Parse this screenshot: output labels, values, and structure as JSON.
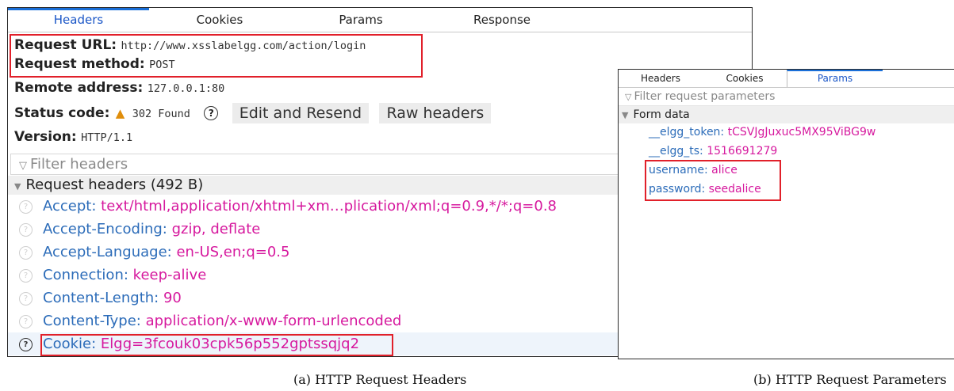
{
  "panel_a": {
    "tabs": [
      "Headers",
      "Cookies",
      "Params",
      "Response"
    ],
    "request_url_label": "Request URL:",
    "request_url_value": "http://www.xsslabelgg.com/action/login",
    "request_method_label": "Request method:",
    "request_method_value": "POST",
    "remote_address_label": "Remote address:",
    "remote_address_value": "127.0.0.1:80",
    "status_code_label": "Status code:",
    "status_code_value": "302 Found",
    "edit_resend_label": "Edit and Resend",
    "raw_headers_label": "Raw headers",
    "version_label": "Version:",
    "version_value": "HTTP/1.1",
    "filter_placeholder": "Filter headers",
    "section_title": "Request headers (492 B)",
    "headers": [
      {
        "name": "Accept:",
        "value": "text/html,application/xhtml+xm…plication/xml;q=0.9,*/*;q=0.8"
      },
      {
        "name": "Accept-Encoding:",
        "value": "gzip, deflate"
      },
      {
        "name": "Accept-Language:",
        "value": "en-US,en;q=0.5"
      },
      {
        "name": "Connection:",
        "value": "keep-alive"
      },
      {
        "name": "Content-Length:",
        "value": "90"
      },
      {
        "name": "Content-Type:",
        "value": "application/x-www-form-urlencoded"
      },
      {
        "name": "Cookie:",
        "value": "Elgg=3fcouk03cpk56p552gptssqjq2"
      }
    ]
  },
  "panel_b": {
    "tabs": [
      "Headers",
      "Cookies",
      "Params"
    ],
    "filter_placeholder": "Filter request parameters",
    "section_title": "Form data",
    "params": [
      {
        "name": "__elgg_token:",
        "value": "tCSVJgJuxuc5MX95ViBG9w"
      },
      {
        "name": "__elgg_ts:",
        "value": "1516691279"
      },
      {
        "name": "username:",
        "value": "alice"
      },
      {
        "name": "password:",
        "value": "seedalice"
      }
    ]
  },
  "captions": {
    "a": "(a)  HTTP Request Headers",
    "b": "(b)  HTTP Request Parameters"
  },
  "colors": {
    "accent": "#1a6fd8",
    "header_name": "#2c6cb9",
    "header_value": "#d6199e",
    "highlight_box": "#e1202a",
    "warning": "#e08e0b"
  }
}
